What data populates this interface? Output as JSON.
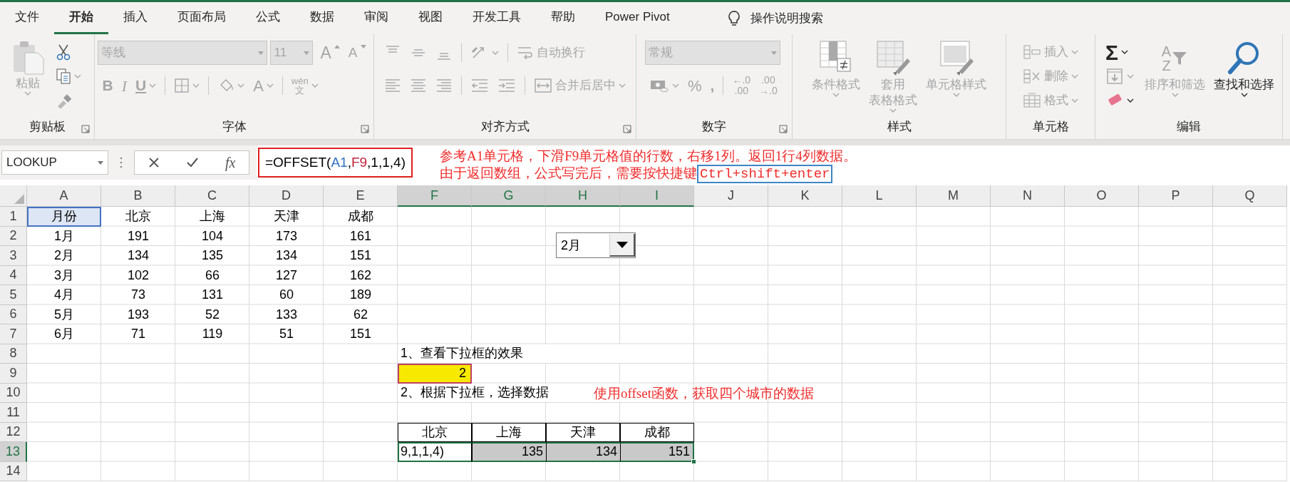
{
  "tabs": [
    {
      "label": "文件",
      "selected": false
    },
    {
      "label": "开始",
      "selected": true
    },
    {
      "label": "插入",
      "selected": false
    },
    {
      "label": "页面布局",
      "selected": false
    },
    {
      "label": "公式",
      "selected": false
    },
    {
      "label": "数据",
      "selected": false
    },
    {
      "label": "审阅",
      "selected": false
    },
    {
      "label": "视图",
      "selected": false
    },
    {
      "label": "开发工具",
      "selected": false
    },
    {
      "label": "帮助",
      "selected": false
    },
    {
      "label": "Power Pivot",
      "selected": false
    }
  ],
  "tell_me": "操作说明搜索",
  "ribbon": [
    {
      "label": "剪贴板",
      "launcher": true,
      "disabled": true,
      "sections": [
        {
          "kind": "large",
          "buttons": [
            {
              "kind": "paste",
              "lines": [
                "粘贴"
              ],
              "dropdown": true
            }
          ]
        },
        {
          "kind": "rows",
          "rows": [
            {
              "tools": [
                {
                  "kind": "cut"
                }
              ]
            },
            {
              "tools": [
                {
                  "kind": "copy",
                  "dropdown": true
                }
              ]
            },
            {
              "tools": [
                {
                  "kind": "painter"
                }
              ]
            }
          ]
        }
      ]
    },
    {
      "label": "字体",
      "launcher": true,
      "disabled": true,
      "sections": [
        {
          "kind": "rows",
          "rows": [
            {
              "tools": [
                {
                  "kind": "font-combo",
                  "text": "等线"
                },
                {
                  "kind": "size-combo",
                  "text": "11"
                },
                {
                  "kind": "glyph-grow",
                  "text": "A"
                },
                {
                  "kind": "glyph-shrink",
                  "text": "A"
                }
              ]
            },
            {
              "tools": [
                {
                  "kind": "glyph-bold",
                  "text": "B"
                },
                {
                  "kind": "glyph-italic",
                  "text": "I"
                },
                {
                  "kind": "glyph-underline",
                  "text": "U",
                  "dropdown": true
                },
                {
                  "kind": "sep"
                },
                {
                  "kind": "borders",
                  "dropdown": true
                },
                {
                  "kind": "sep"
                },
                {
                  "kind": "fill",
                  "dropdown": true
                },
                {
                  "kind": "glyph-plain",
                  "text": "A",
                  "dropdown": true
                },
                {
                  "kind": "sep"
                },
                {
                  "kind": "phonetic",
                  "text": "wén",
                  "text2": "文",
                  "dropdown": true
                }
              ]
            }
          ]
        }
      ]
    },
    {
      "label": "对齐方式",
      "launcher": true,
      "disabled": true,
      "sections": [
        {
          "kind": "rows",
          "rows": [
            {
              "tools": [
                {
                  "kind": "align-top"
                },
                {
                  "kind": "align-middle"
                },
                {
                  "kind": "align-bottom"
                },
                {
                  "kind": "sep"
                },
                {
                  "kind": "orientation",
                  "dropdown": true
                },
                {
                  "kind": "sep"
                },
                {
                  "kind": "wrap",
                  "text": "自动换行"
                }
              ]
            },
            {
              "tools": [
                {
                  "kind": "align-left"
                },
                {
                  "kind": "align-center"
                },
                {
                  "kind": "align-right"
                },
                {
                  "kind": "sep"
                },
                {
                  "kind": "indent-decrease"
                },
                {
                  "kind": "indent-increase"
                },
                {
                  "kind": "sep"
                },
                {
                  "kind": "merge",
                  "text": "合并后居中",
                  "dropdown": true
                }
              ]
            }
          ]
        }
      ]
    },
    {
      "label": "数字",
      "launcher": true,
      "disabled": true,
      "sections": [
        {
          "kind": "rows",
          "rows": [
            {
              "tools": [
                {
                  "kind": "format-combo",
                  "text": "常规"
                }
              ]
            },
            {
              "tools": [
                {
                  "kind": "currency",
                  "dropdown": true
                },
                {
                  "kind": "glyph-plain",
                  "text": "%"
                },
                {
                  "kind": "glyph-bold",
                  "text": ","
                },
                {
                  "kind": "sep"
                },
                {
                  "kind": "stack",
                  "lines": [
                    "←.0",
                    ".00"
                  ]
                },
                {
                  "kind": "stack",
                  "lines": [
                    ".00",
                    "→.0"
                  ]
                }
              ]
            }
          ]
        }
      ]
    },
    {
      "label": "样式",
      "launcher": false,
      "disabled": true,
      "sections": [
        {
          "kind": "large",
          "buttons": [
            {
              "kind": "conditional",
              "lines": [
                "条件格式"
              ],
              "dropdown": true
            },
            {
              "kind": "table",
              "lines": [
                "套用",
                "表格格式"
              ],
              "dropdown": true
            },
            {
              "kind": "cell-styles",
              "lines": [
                "单元格样式"
              ],
              "dropdown": true
            }
          ]
        }
      ]
    },
    {
      "label": "单元格",
      "launcher": false,
      "disabled": true,
      "sections": [
        {
          "kind": "rows",
          "rows": [
            {
              "tools": [
                {
                  "kind": "insert-cells",
                  "text": "插入",
                  "dropdown": true
                }
              ]
            },
            {
              "tools": [
                {
                  "kind": "delete-cells",
                  "text": "删除",
                  "dropdown": true
                }
              ]
            },
            {
              "tools": [
                {
                  "kind": "format-cells",
                  "text": "格式",
                  "dropdown": true
                }
              ]
            }
          ]
        }
      ]
    },
    {
      "label": "编辑",
      "launcher": false,
      "sections": [
        {
          "kind": "rows",
          "rows": [
            {
              "tools": [
                {
                  "kind": "sum",
                  "text": "Σ",
                  "dropdown": true,
                  "disabled": false
                }
              ]
            },
            {
              "tools": [
                {
                  "kind": "fill-down",
                  "dropdown": true,
                  "disabled": true
                }
              ]
            },
            {
              "tools": [
                {
                  "kind": "clear",
                  "dropdown": true,
                  "disabled": false
                }
              ]
            }
          ]
        },
        {
          "kind": "large",
          "buttons": [
            {
              "kind": "sort",
              "glyphs": [
                "A",
                "Z"
              ],
              "lines": [
                "排序和筛选"
              ],
              "dropdown": true,
              "disabled": true
            },
            {
              "kind": "find",
              "lines": [
                "查找和选择"
              ],
              "dropdown": true,
              "disabled": false
            }
          ]
        }
      ]
    }
  ],
  "formula_bar": {
    "name_box": "LOOKUP",
    "function_glyph": "fx",
    "highlighted": true,
    "formula_parts": [
      {
        "text": "=OFFSET("
      },
      {
        "text": "A1",
        "color": "#2f6fc0"
      },
      {
        "text": ","
      },
      {
        "text": "F9",
        "color": "#c0203a"
      },
      {
        "text": ",1,1,4)"
      }
    ]
  },
  "sheet": {
    "columns": [
      {
        "label": "A",
        "selected": false
      },
      {
        "label": "B",
        "selected": false
      },
      {
        "label": "C",
        "selected": false
      },
      {
        "label": "D",
        "selected": false
      },
      {
        "label": "E",
        "selected": false
      },
      {
        "label": "F",
        "selected": true
      },
      {
        "label": "G",
        "selected": true
      },
      {
        "label": "H",
        "selected": true
      },
      {
        "label": "I",
        "selected": true
      },
      {
        "label": "J",
        "selected": false
      },
      {
        "label": "K",
        "selected": false
      },
      {
        "label": "L",
        "selected": false
      },
      {
        "label": "M",
        "selected": false
      },
      {
        "label": "N",
        "selected": false
      },
      {
        "label": "O",
        "selected": false
      },
      {
        "label": "P",
        "selected": false
      },
      {
        "label": "Q",
        "selected": false
      }
    ],
    "rows": [
      {
        "label": "1",
        "selected": false,
        "cells": [
          {
            "kind": "ref_blue",
            "text": "月份"
          },
          {
            "kind": "value",
            "text": "北京"
          },
          {
            "kind": "value",
            "text": "上海"
          },
          {
            "kind": "value",
            "text": "天津"
          },
          {
            "kind": "value",
            "text": "成都"
          }
        ]
      },
      {
        "label": "2",
        "selected": false,
        "cells": [
          {
            "kind": "value",
            "text": "1月"
          },
          {
            "kind": "value",
            "text": "191"
          },
          {
            "kind": "value",
            "text": "104"
          },
          {
            "kind": "value",
            "text": "173"
          },
          {
            "kind": "value",
            "text": "161"
          }
        ]
      },
      {
        "label": "3",
        "selected": false,
        "cells": [
          {
            "kind": "value",
            "text": "2月"
          },
          {
            "kind": "value",
            "text": "134"
          },
          {
            "kind": "value",
            "text": "135"
          },
          {
            "kind": "value",
            "text": "134"
          },
          {
            "kind": "value",
            "text": "151"
          }
        ]
      },
      {
        "label": "4",
        "selected": false,
        "cells": [
          {
            "kind": "value",
            "text": "3月"
          },
          {
            "kind": "value",
            "text": "102"
          },
          {
            "kind": "value",
            "text": "66"
          },
          {
            "kind": "value",
            "text": "127"
          },
          {
            "kind": "value",
            "text": "162"
          }
        ]
      },
      {
        "label": "5",
        "selected": false,
        "cells": [
          {
            "kind": "value",
            "text": "4月"
          },
          {
            "kind": "value",
            "text": "73"
          },
          {
            "kind": "value",
            "text": "131"
          },
          {
            "kind": "value",
            "text": "60"
          },
          {
            "kind": "value",
            "text": "189"
          }
        ]
      },
      {
        "label": "6",
        "selected": false,
        "cells": [
          {
            "kind": "value",
            "text": "5月"
          },
          {
            "kind": "value",
            "text": "193"
          },
          {
            "kind": "value",
            "text": "52"
          },
          {
            "kind": "value",
            "text": "133"
          },
          {
            "kind": "value",
            "text": "62"
          }
        ]
      },
      {
        "label": "7",
        "selected": false,
        "cells": [
          {
            "kind": "value",
            "text": "6月"
          },
          {
            "kind": "value",
            "text": "71"
          },
          {
            "kind": "value",
            "text": "119"
          },
          {
            "kind": "value",
            "text": "51"
          },
          {
            "kind": "value",
            "text": "151"
          }
        ]
      },
      {
        "label": "8",
        "selected": false,
        "cells": [
          "",
          "",
          "",
          "",
          "",
          {
            "kind": "text",
            "text": "1、查看下拉框的效果"
          }
        ]
      },
      {
        "label": "9",
        "selected": false,
        "cells": [
          "",
          "",
          "",
          "",
          "",
          {
            "kind": "ref_red",
            "text": "2"
          }
        ]
      },
      {
        "label": "10",
        "selected": false,
        "cells": [
          "",
          "",
          "",
          "",
          "",
          {
            "kind": "text",
            "text": "2、根据下拉框，选择数据"
          }
        ]
      },
      {
        "label": "11",
        "selected": false
      },
      {
        "label": "12",
        "selected": false,
        "cells": [
          "",
          "",
          "",
          "",
          "",
          {
            "kind": "table_header",
            "text": "北京"
          },
          {
            "kind": "table_header",
            "text": "上海"
          },
          {
            "kind": "table_header",
            "text": "天津"
          },
          {
            "kind": "table_header",
            "text": "成都"
          }
        ]
      },
      {
        "label": "13",
        "selected": true,
        "cells": [
          "",
          "",
          "",
          "",
          "",
          {
            "kind": "editing",
            "text": "9,1,1,4)"
          },
          {
            "kind": "table_value",
            "text": "135"
          },
          {
            "kind": "table_value",
            "text": "134"
          },
          {
            "kind": "table_value",
            "text": "151"
          }
        ]
      },
      {
        "label": "14",
        "selected": false
      }
    ]
  },
  "dropdown": {
    "value": "2月"
  },
  "annotations": [
    {
      "text": "参考A1单元格，下滑F9单元格值的行数，右移1列。返回1行4列数据。"
    },
    {
      "text": "由于返回数组，公式写完后，需要按快捷键",
      "boxed": "Ctrl+shift+enter"
    },
    {
      "text": "使用offset函数，获取四个城市的数据"
    }
  ]
}
